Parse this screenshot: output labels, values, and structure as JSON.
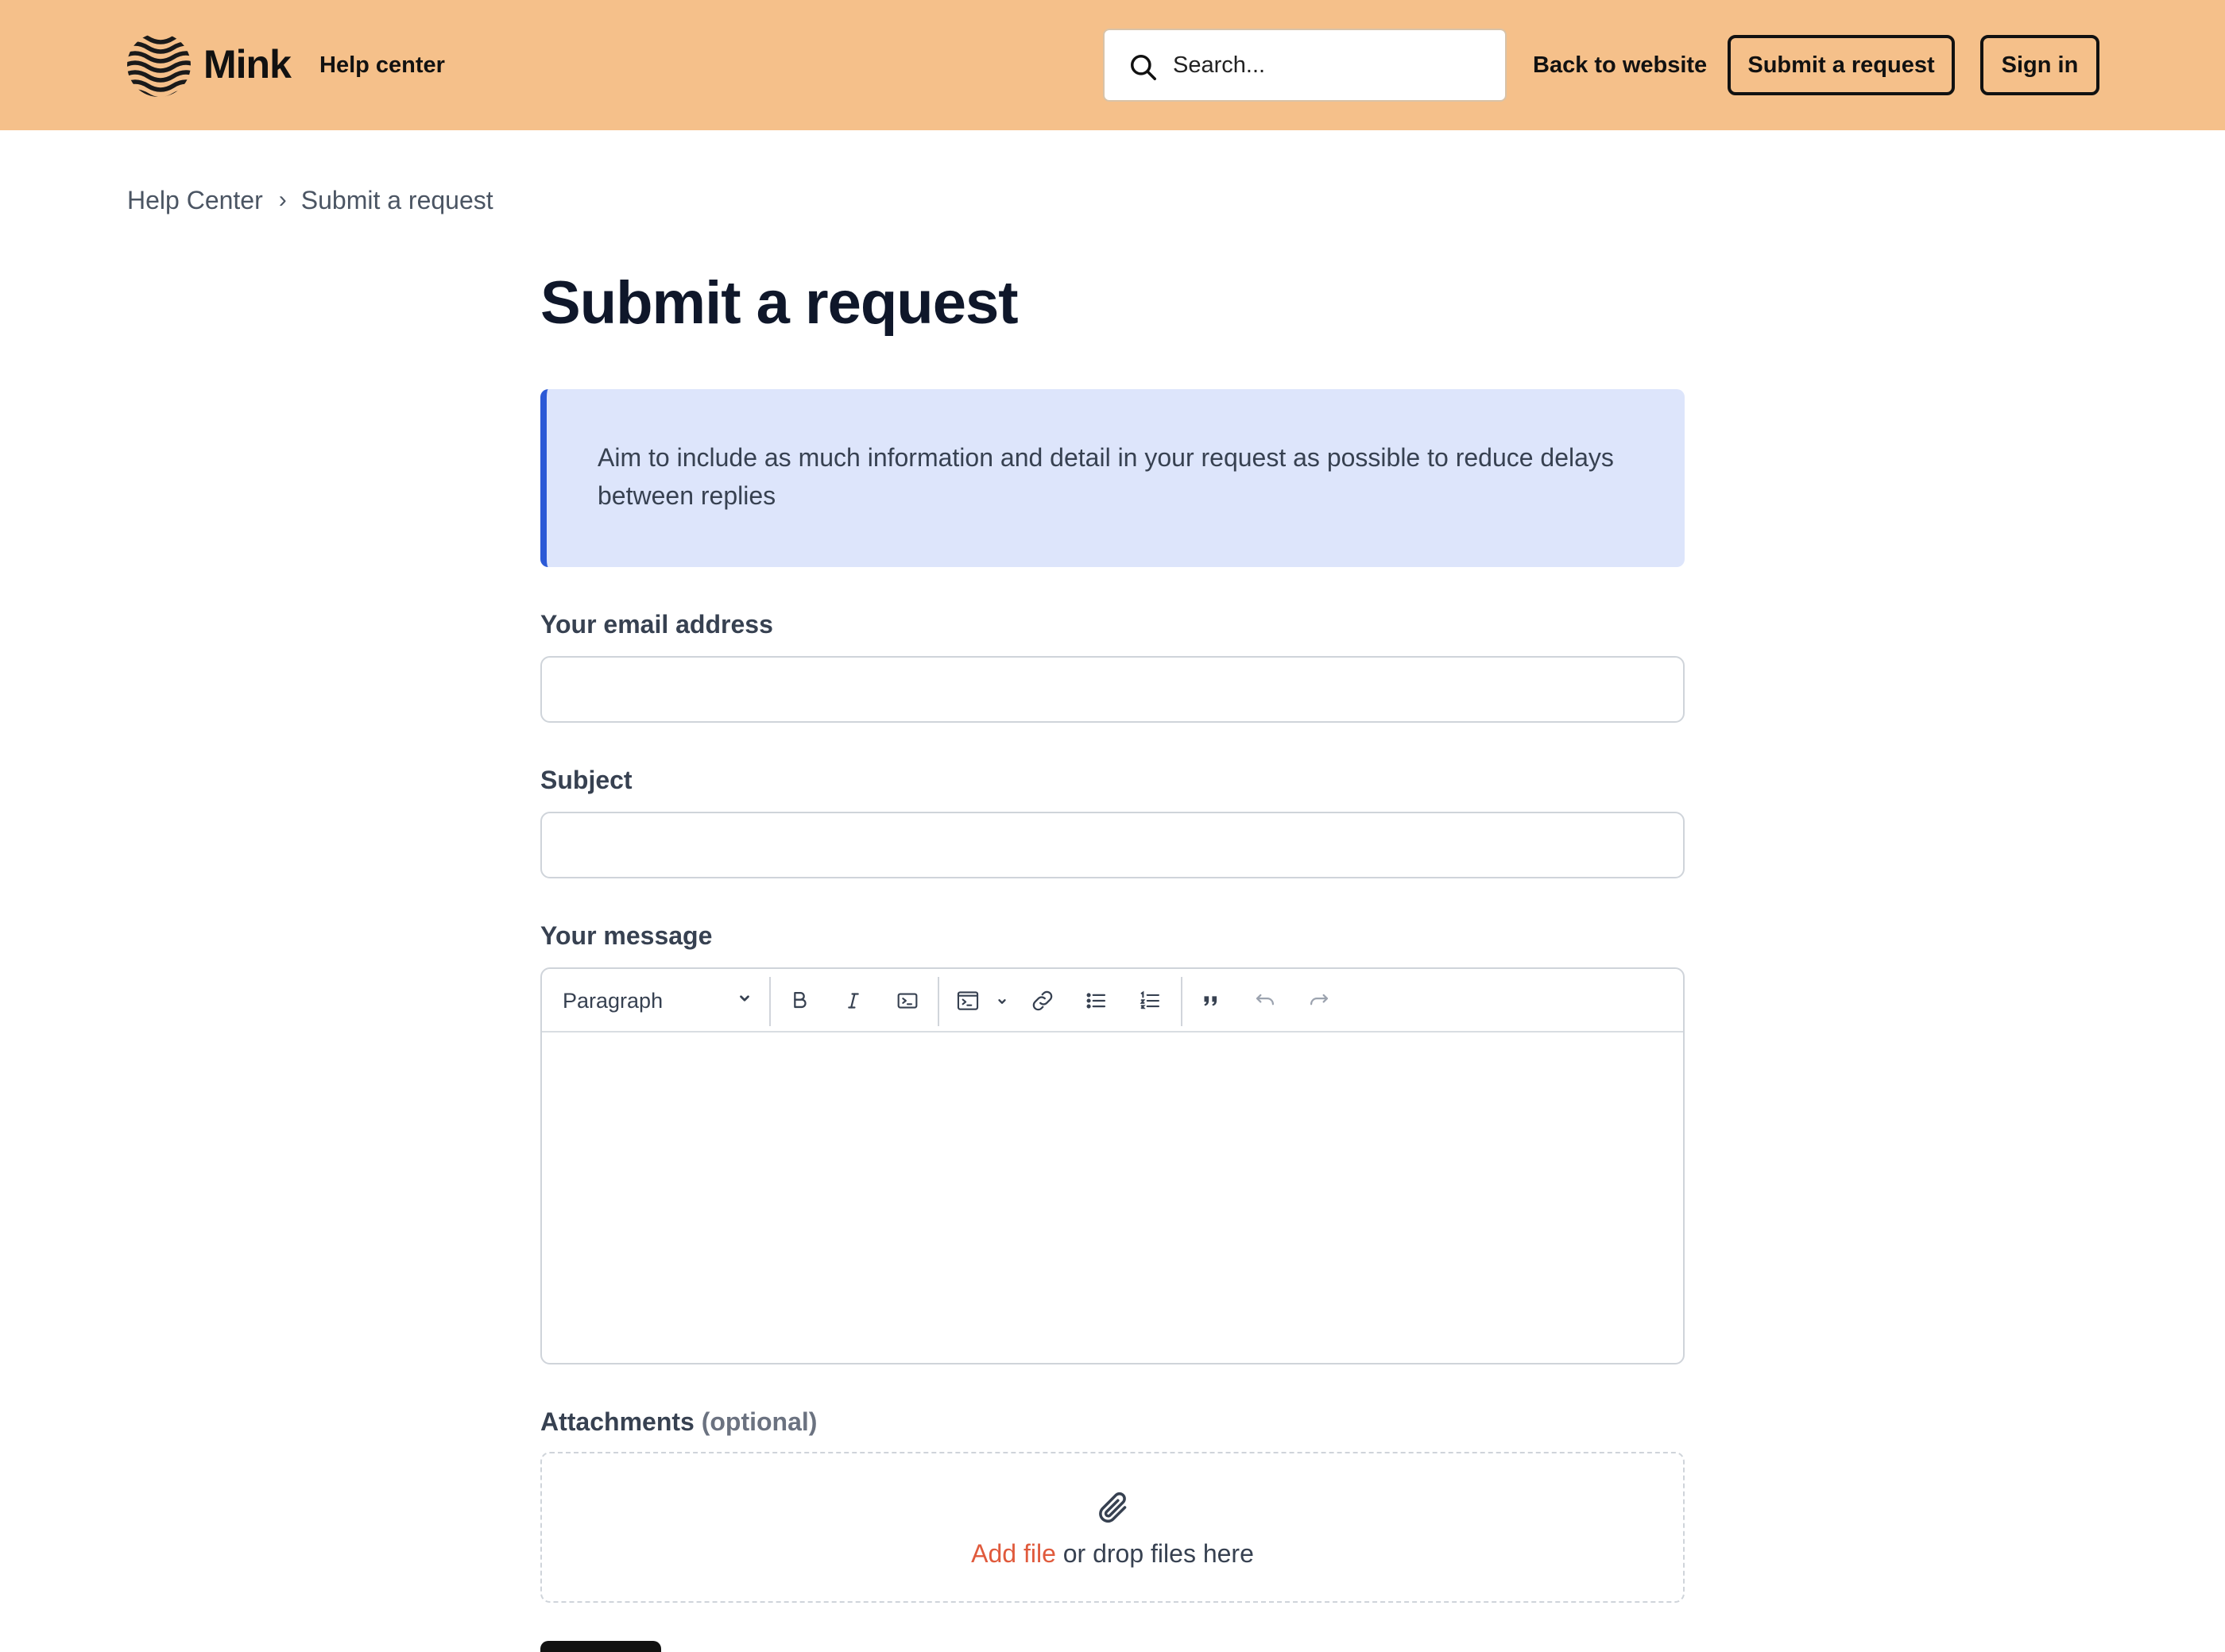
{
  "header": {
    "brand": "Mink",
    "help_center": "Help center",
    "search_placeholder": "Search...",
    "back_link": "Back to website",
    "submit_request": "Submit a request",
    "sign_in": "Sign in",
    "background_color": "#f5c08a"
  },
  "breadcrumb": {
    "items": [
      "Help Center",
      "Submit a request"
    ],
    "separator": "›"
  },
  "main": {
    "title": "Submit a request",
    "notice": "Aim to include as much information and detail in your request as possible to reduce delays between replies",
    "notice_accent": "#2b59d6",
    "fields": {
      "email_label": "Your email address",
      "subject_label": "Subject",
      "message_label": "Your message"
    },
    "editor": {
      "format_select": "Paragraph",
      "toolbar_icons": [
        "bold-icon",
        "italic-icon",
        "code-icon",
        "code-block-icon",
        "link-icon",
        "bulleted-list-icon",
        "numbered-list-icon",
        "quote-icon",
        "undo-icon",
        "redo-icon"
      ]
    },
    "attachments": {
      "label": "Attachments",
      "optional": "(optional)",
      "add_file": "Add file",
      "drop_text": " or drop files here",
      "link_color": "#e05a3c"
    }
  }
}
